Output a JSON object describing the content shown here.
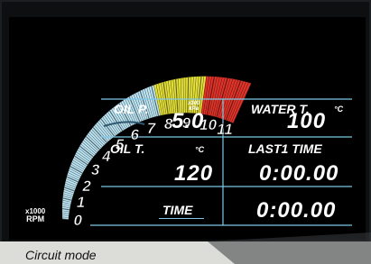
{
  "caption": "Circuit mode",
  "tachometer": {
    "ticks": [
      "0",
      "1",
      "2",
      "3",
      "4",
      "5",
      "6",
      "7",
      "8",
      "9",
      "10",
      "11"
    ],
    "unit_top": "x1000",
    "unit_bottom": "RPM",
    "colors": {
      "normal": "#bfe9f8",
      "caution": "#e6e23a",
      "redline": "#e2342a"
    }
  },
  "readouts": {
    "oil_pressure": {
      "label": "OIL P.",
      "unit_top": "x100",
      "unit_bottom": "kPa",
      "value": "5.0"
    },
    "water_temp": {
      "label": "WATER T.",
      "unit": "°C",
      "value": "100"
    },
    "oil_temp": {
      "label": "OIL T.",
      "unit": "°C",
      "value": "120"
    },
    "last_lap": {
      "label": "LAST1 TIME",
      "value": "0:00.00"
    },
    "time": {
      "label": "TIME",
      "value": "0:00.00"
    }
  }
}
